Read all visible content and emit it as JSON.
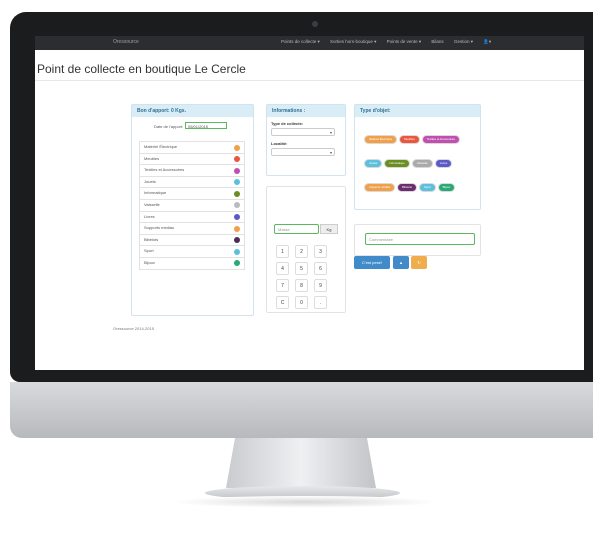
{
  "navbar": {
    "brand": "Oressource",
    "items": [
      "Points de collecte ▾",
      "Sorties hors-boutique ▾",
      "Points de vente ▾",
      "Bilans",
      "Gestion ▾",
      "👤▾"
    ]
  },
  "page_title": "Point de collecte en boutique Le Cercle",
  "bon": {
    "header": "Bon d'apport: 0 Kgs.",
    "date_label": "Date de l'apport:",
    "date_value": "05/01/2015",
    "items": [
      {
        "label": "Matériel Électrique",
        "color": "#f0a04b"
      },
      {
        "label": "Meubles",
        "color": "#e9573f"
      },
      {
        "label": "Textiles et Accessoires",
        "color": "#c14fb0"
      },
      {
        "label": "Jouets",
        "color": "#5bc0de"
      },
      {
        "label": "Informatique",
        "color": "#6b8e23"
      },
      {
        "label": "Vaisselle",
        "color": "#bbbbbb"
      },
      {
        "label": "Livres",
        "color": "#5b5bc8"
      },
      {
        "label": "Supports médias",
        "color": "#f0a04b"
      },
      {
        "label": "Bibelots",
        "color": "#4a2d5a"
      },
      {
        "label": "Sport",
        "color": "#5bc0de"
      },
      {
        "label": "Bijoux",
        "color": "#2aa876"
      }
    ]
  },
  "info": {
    "header": "Informations :",
    "type_label": "Type de collecte:",
    "localite_label": "Localité:"
  },
  "keypad": {
    "mass_placeholder": "Masse",
    "unit": "Kg",
    "keys": [
      "1",
      "2",
      "3",
      "4",
      "5",
      "6",
      "7",
      "8",
      "9",
      "C",
      "0",
      "."
    ]
  },
  "type_objet": {
    "header": "Type d'objet:",
    "tags": [
      {
        "label": "Matériel Électrique",
        "color": "#f0a04b"
      },
      {
        "label": "Meubles",
        "color": "#e9573f"
      },
      {
        "label": "Textiles et Accessoires",
        "color": "#c14fb0"
      },
      {
        "label": "Jouets",
        "color": "#5bc0de"
      },
      {
        "label": "Informatique",
        "color": "#6b8e23"
      },
      {
        "label": "Vaisselle",
        "color": "#aaaaaa"
      },
      {
        "label": "Livres",
        "color": "#5b5bc8"
      },
      {
        "label": "Supports médias",
        "color": "#f0a04b"
      },
      {
        "label": "Bibelots",
        "color": "#6b2d6e"
      },
      {
        "label": "Sport",
        "color": "#5bc0de"
      },
      {
        "label": "Bijoux",
        "color": "#2aa876"
      }
    ]
  },
  "comment_placeholder": "Commentaire",
  "actions": {
    "submit_label": "C'est pesé!",
    "submit_color": "#428bca",
    "print_color": "#428bca",
    "reset_color": "#f0ad4e"
  },
  "footer": "Oressource 2014-2015"
}
